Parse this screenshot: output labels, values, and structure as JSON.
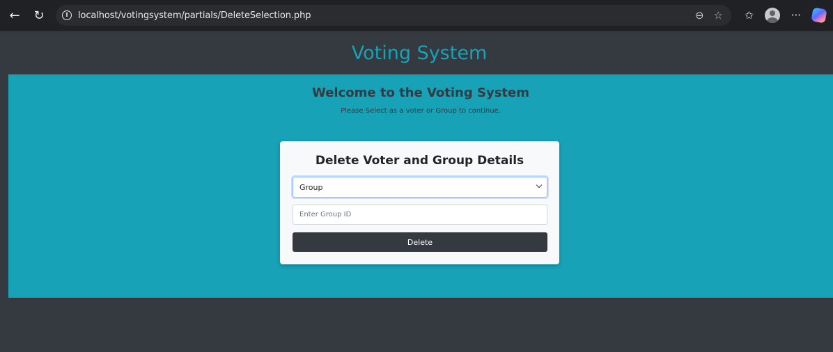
{
  "browser": {
    "url": "localhost/votingsystem/partials/DeleteSelection.php"
  },
  "header": {
    "title": "Voting System"
  },
  "hero": {
    "title": "Welcome to the Voting System",
    "subtitle": "Please Select as a voter or Group to continue."
  },
  "form": {
    "title": "Delete Voter and Group Details",
    "select_value": "Group",
    "id_placeholder": "Enter Group ID",
    "id_value": "",
    "delete_label": "Delete"
  },
  "colors": {
    "accent": "#17a2b8",
    "dark": "#343a40",
    "card": "#f8f9fa"
  },
  "icons": {
    "back": "back-arrow-icon",
    "reload": "reload-icon",
    "info": "info-icon",
    "zoom": "zoom-icon",
    "favorite": "star-icon",
    "favorites": "favorites-icon",
    "profile": "profile-avatar-icon",
    "more": "more-icon",
    "copilot": "copilot-icon"
  }
}
